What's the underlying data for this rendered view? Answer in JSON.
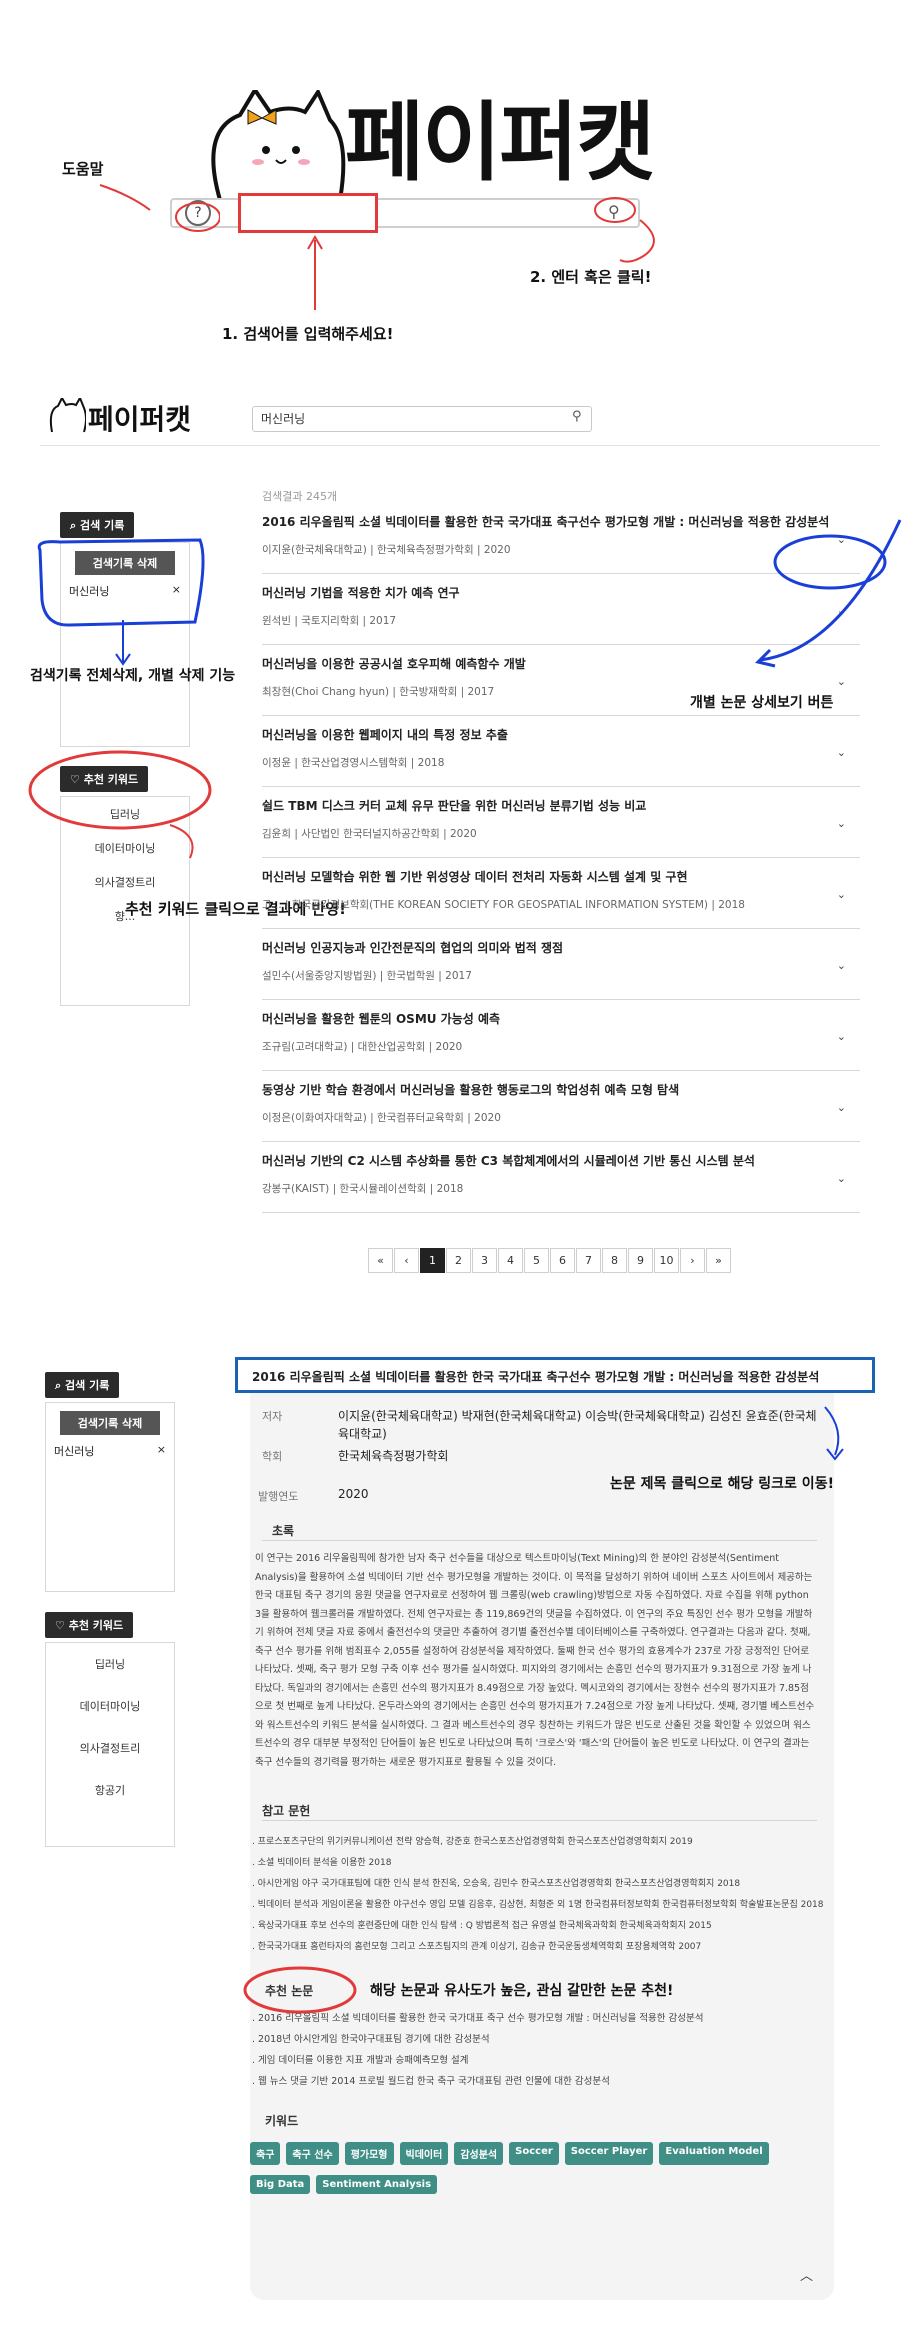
{
  "hero": {
    "logo": "페이퍼캣",
    "help_glyph": "?",
    "search_glyph": "⚲",
    "annotations": {
      "help": "도움말",
      "enter": "2. 엔터 혹은 클릭!",
      "input": "1. 검색어를 입력해주세요!"
    }
  },
  "header": {
    "logo": "페이퍼캣",
    "search_value": "머신러닝",
    "search_glyph": "⚲"
  },
  "sidebar": {
    "history_tab": "검색 기록",
    "clear_all": "검색기록 삭제",
    "history_items": [
      {
        "label": "머신러닝",
        "remove": "×"
      }
    ],
    "keyword_tab": "추천 키워드",
    "keywords_short": [
      "딥러닝",
      "데이터마이닝",
      "의사결정트리",
      "향..."
    ],
    "keywords_full": [
      "딥러닝",
      "데이터마이닝",
      "의사결정트리",
      "항공기"
    ]
  },
  "results": {
    "count_text": "검색결과 245개",
    "chevron": "⌄",
    "items": [
      {
        "title": "2016 리우올림픽 소셜 빅데이터를 활용한 한국 국가대표 축구선수 평가모형 개발 : 머신러닝을 적용한 감성분석",
        "meta": "이지윤(한국체육대학교) | 한국체육측정평가학회 | 2020"
      },
      {
        "title": "머신러닝 기법을 적용한 치가 예측 연구",
        "meta": "윈석빈 | 국토지리학회 | 2017"
      },
      {
        "title": "머신러닝을 이용한 공공시설 호우피해 예측함수 개발",
        "meta": "최창현(Choi Chang hyun) | 한국방재학회 | 2017"
      },
      {
        "title": "머신러닝을 이용한 웹페이지 내의 특정 정보 추출",
        "meta": "이정윤 | 한국산업경영시스템학회 | 2018"
      },
      {
        "title": "쉴드 TBM 디스크 커터 교체 유무 판단을 위한 머신러닝 분류기법 성능 비교",
        "meta": "김윤희 | 사단법인 한국터널지하공간학회 | 2020"
      },
      {
        "title": "머신러닝 모델학습 위한 웹 기반 위성영상 데이터 전처리 자동화 시스템 설계 및 구현",
        "meta": "고... | 한국공간정보학회(THE KOREAN SOCIETY FOR GEOSPATIAL INFORMATION SYSTEM) | 2018"
      },
      {
        "title": "머신러닝 인공지능과 인간전문직의 협업의 의미와 법적 쟁점",
        "meta": "설민수(서울중앙지방법원) | 한국법학원 | 2017"
      },
      {
        "title": "머신러닝을 활용한 웹툰의 OSMU 가능성 예측",
        "meta": "조규림(고려대학교) | 대한산업공학회 | 2020"
      },
      {
        "title": "동영상 기반 학습 환경에서 머신러닝을 활용한 행동로그의 학업성취 예측 모형 탐색",
        "meta": "이정은(이화여자대학교) | 한국컴퓨터교육학회 | 2020"
      },
      {
        "title": "머신러닝 기반의 C2 시스템 추상화를 통한 C3 복합체계에서의 시뮬레이션 기반 통신 시스템 분석",
        "meta": "강봉구(KAIST) | 한국시뮬레이션학회 | 2018"
      }
    ],
    "annotations": {
      "history": "검색기록 전체삭제, 개별 삭제 기능",
      "detail": "개별 논문 상세보기 버튼",
      "keyword": "추천 키워드 클릭으로 결과에 반영!"
    }
  },
  "pager": {
    "first": "«",
    "prev": "‹",
    "next": "›",
    "last": "»",
    "pages": [
      "1",
      "2",
      "3",
      "4",
      "5",
      "6",
      "7",
      "8",
      "9",
      "10"
    ]
  },
  "detail": {
    "title": "2016 리우올림픽 소셜 빅데이터를 활용한 한국 국가대표 축구선수 평가모형 개발 : 머신러닝을 적용한 감성분석",
    "author_label": "저자",
    "authors_line1": "이지윤(한국체육대학교) 박재현(한국체육대학교) 이승박(한국체육대학교) 김성진 윤효준(한국체",
    "authors_line2": "육대학교)",
    "society_label": "학회",
    "society": "한국체육측정평가학회",
    "year_label": "발행연도",
    "year": "2020",
    "abstract_heading": "초록",
    "abstract": "이 연구는 2016 리우올림픽에 참가한 남자 축구 선수들을 대상으로 텍스트마이닝(Text Mining)의 한 분야인 감성분석(Sentiment Analysis)을 활용하여 소셜 빅데이터 기반 선수 평가모형을 개발하는 것이다. 이 목적을 달성하기 위하여 네이버 스포츠 사이트에서 제공하는 한국 대표팀 축구 경기의 응원 댓글을 연구자료로 선정하여 웹 크롤링(web crawling)방법으로 자동 수집하였다. 자료 수집을 위해 python 3을 활용하여 웹크롤러를 개발하였다. 전체 연구자료는 총 119,869건의 댓글을 수집하였다. 이 연구의 주요 특징인 선수 평가 모형을 개발하기 위하여 전체 댓글 자료 중에서 출전선수의 댓글만 추출하여 경기별 출전선수별 데이터베이스를 구축하였다. 연구결과는 다음과 같다. 첫째, 축구 선수 평가를 위해 범죄표수 2,055를 설정하여 감성분석을 제작하였다. 둘째 한국 선수 평가의 효용계수가 237로 가장 긍정적인 단어로 나타났다. 셋째, 축구 평가 모형 구축 이후 선수 평가를 실시하였다. 피지와의 경기에서는 손흥민 선수의 평가지표가 9.31점으로 가장 높게 나타났다. 독일과의 경기에서는 손흥민 선수의 평가지표가 8.49점으로 가장 높았다. 멕시코와의 경기에서는 장현수 선수의 평가지표가 7.85점으로 첫 번째로 높게 나타났다. 온두라스와의 경기에서는 손흥민 선수의 평가지표가 7.24점으로 가장 높게 나타났다. 셋째, 경기별 베스트선수와 워스트선수의 키워드 분석을 실시하였다. 그 결과 베스트선수의 경우 칭찬하는 키워드가 많은 빈도로 산출된 것을 확인할 수 있었으며 워스트선수의 경우 대부분 부정적인 단어들이 높은 빈도로 나타났으며 특히 '크로스'와 '패스'의 단어들이 높은 빈도로 나타났다. 이 연구의 결과는 축구 선수들의 경기력을 평가하는 새로운 평가지표로 활용될 수 있을 것이다.",
    "ref_heading": "참고 문헌",
    "references": [
      ". 프로스포츠구단의 위기커뮤니케이션 전략 양승혁, 강준호 한국스포츠산업경영학회 한국스포츠산업경영학회지 2019",
      ". 소셜 빅데이터 분석을 이용한 2018",
      ". 아시안게임 야구 국가대표팀에 대한 인식 분석 한진욱, 오승욱, 김민수 한국스포츠산업경영학회 한국스포츠산업경영학회지 2018",
      ". 빅데이터 분석과 게임이론을 활용한 야구선수 영입 모델 김응후, 김상현, 최형준 외 1명 한국컴퓨터정보학회 한국컴퓨터정보학회 학술발표논문집 2018",
      ". 육상국가대표 후보 선수의 훈련중단에 대한 인식 탐색 : Q 방법론적 접근 유영설 한국체육과학회 한국체육과학회지 2015",
      ". 한국국가대표 홈런타자의 홈런모형 그리고 스포츠팀지의 관계 이상기, 김송규 한국운동생체역학회 포장용체역학 2007"
    ],
    "rec_heading": "추천 논문",
    "recommendations": [
      ". 2016 리우올림픽 소셜 빅데이터를 활용한 한국 국가대표 축구 선수 평가모형 개발 : 머신러닝을 적용한 감성분석",
      ". 2018년 아시안게임 한국야구대표팀 경기에 대한 감성분석",
      ". 게임 데이터를 이용한 지표 개발과 승패예측모형 설계",
      ". 웹 뉴스 댓글 기반 2014 프로빌 월드컵 한국 축구 국가대표팀 관련 인물에 대한 감성분석"
    ],
    "kw_heading": "키워드",
    "keywords": [
      "축구",
      "축구 선수",
      "평가모형",
      "빅데이터",
      "감성분석",
      "Soccer",
      "Soccer Player",
      "Evaluation Model",
      "Big Data",
      "Sentiment Analysis"
    ],
    "collapse_glyph": "︿",
    "annotations": {
      "title_link": "논문 제목 클릭으로 해당 링크로 이동!",
      "rec": "해당 논문과 유사도가 높은, 관심 갈만한 논문 추천!"
    }
  },
  "colors": {
    "accent_blue": "#1a63b3",
    "annotation_red": "#e23a3a",
    "keyword_chip": "#3f8f86"
  }
}
